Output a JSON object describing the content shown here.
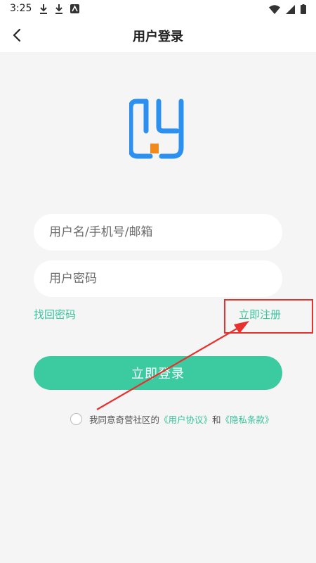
{
  "status_bar": {
    "time": "3:25"
  },
  "header": {
    "title": "用户登录"
  },
  "login_form": {
    "username_placeholder": "用户名/手机号/邮箱",
    "password_placeholder": "用户密码",
    "forgot_password": "找回密码",
    "register": "立即注册",
    "login_button": "立即登录"
  },
  "agreement": {
    "prefix": "我同意奇营社区的",
    "user_agreement": "《用户协议》",
    "conjunction": "和",
    "privacy_policy": "《隐私条款》",
    "checked": false
  },
  "colors": {
    "accent": "#3ccaa0",
    "link": "#37c49a",
    "logo_blue": "#2b90f0",
    "logo_orange": "#f08a1e",
    "annotation_red": "#e8312d"
  }
}
